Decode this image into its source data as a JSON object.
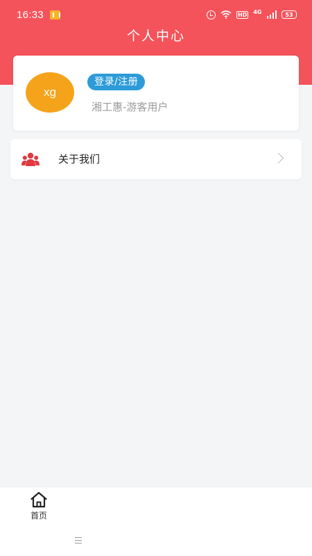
{
  "status_bar": {
    "time": "16:33",
    "icons": [
      "app-notification-icon",
      "alarm-icon",
      "wifi-icon",
      "hd-icon",
      "4g-icon",
      "signal-icon",
      "battery-icon"
    ],
    "hd_label": "HD",
    "network_label": "4G",
    "battery_level": "53"
  },
  "header": {
    "title": "个人中心",
    "background_color": "#f4535b"
  },
  "profile": {
    "avatar_text": "xg",
    "avatar_color": "#f5a31a",
    "login_label": "登录/注册",
    "login_color": "#2d9bd9",
    "user_type": "湘工惠-游客用户"
  },
  "menu": {
    "items": [
      {
        "label": "关于我们",
        "icon": "users-icon",
        "icon_color": "#e0393f",
        "trailing_icon": "chevron-right-icon"
      }
    ]
  },
  "tab_bar": {
    "tabs": [
      {
        "label": "首页",
        "icon": "home-icon"
      }
    ]
  }
}
